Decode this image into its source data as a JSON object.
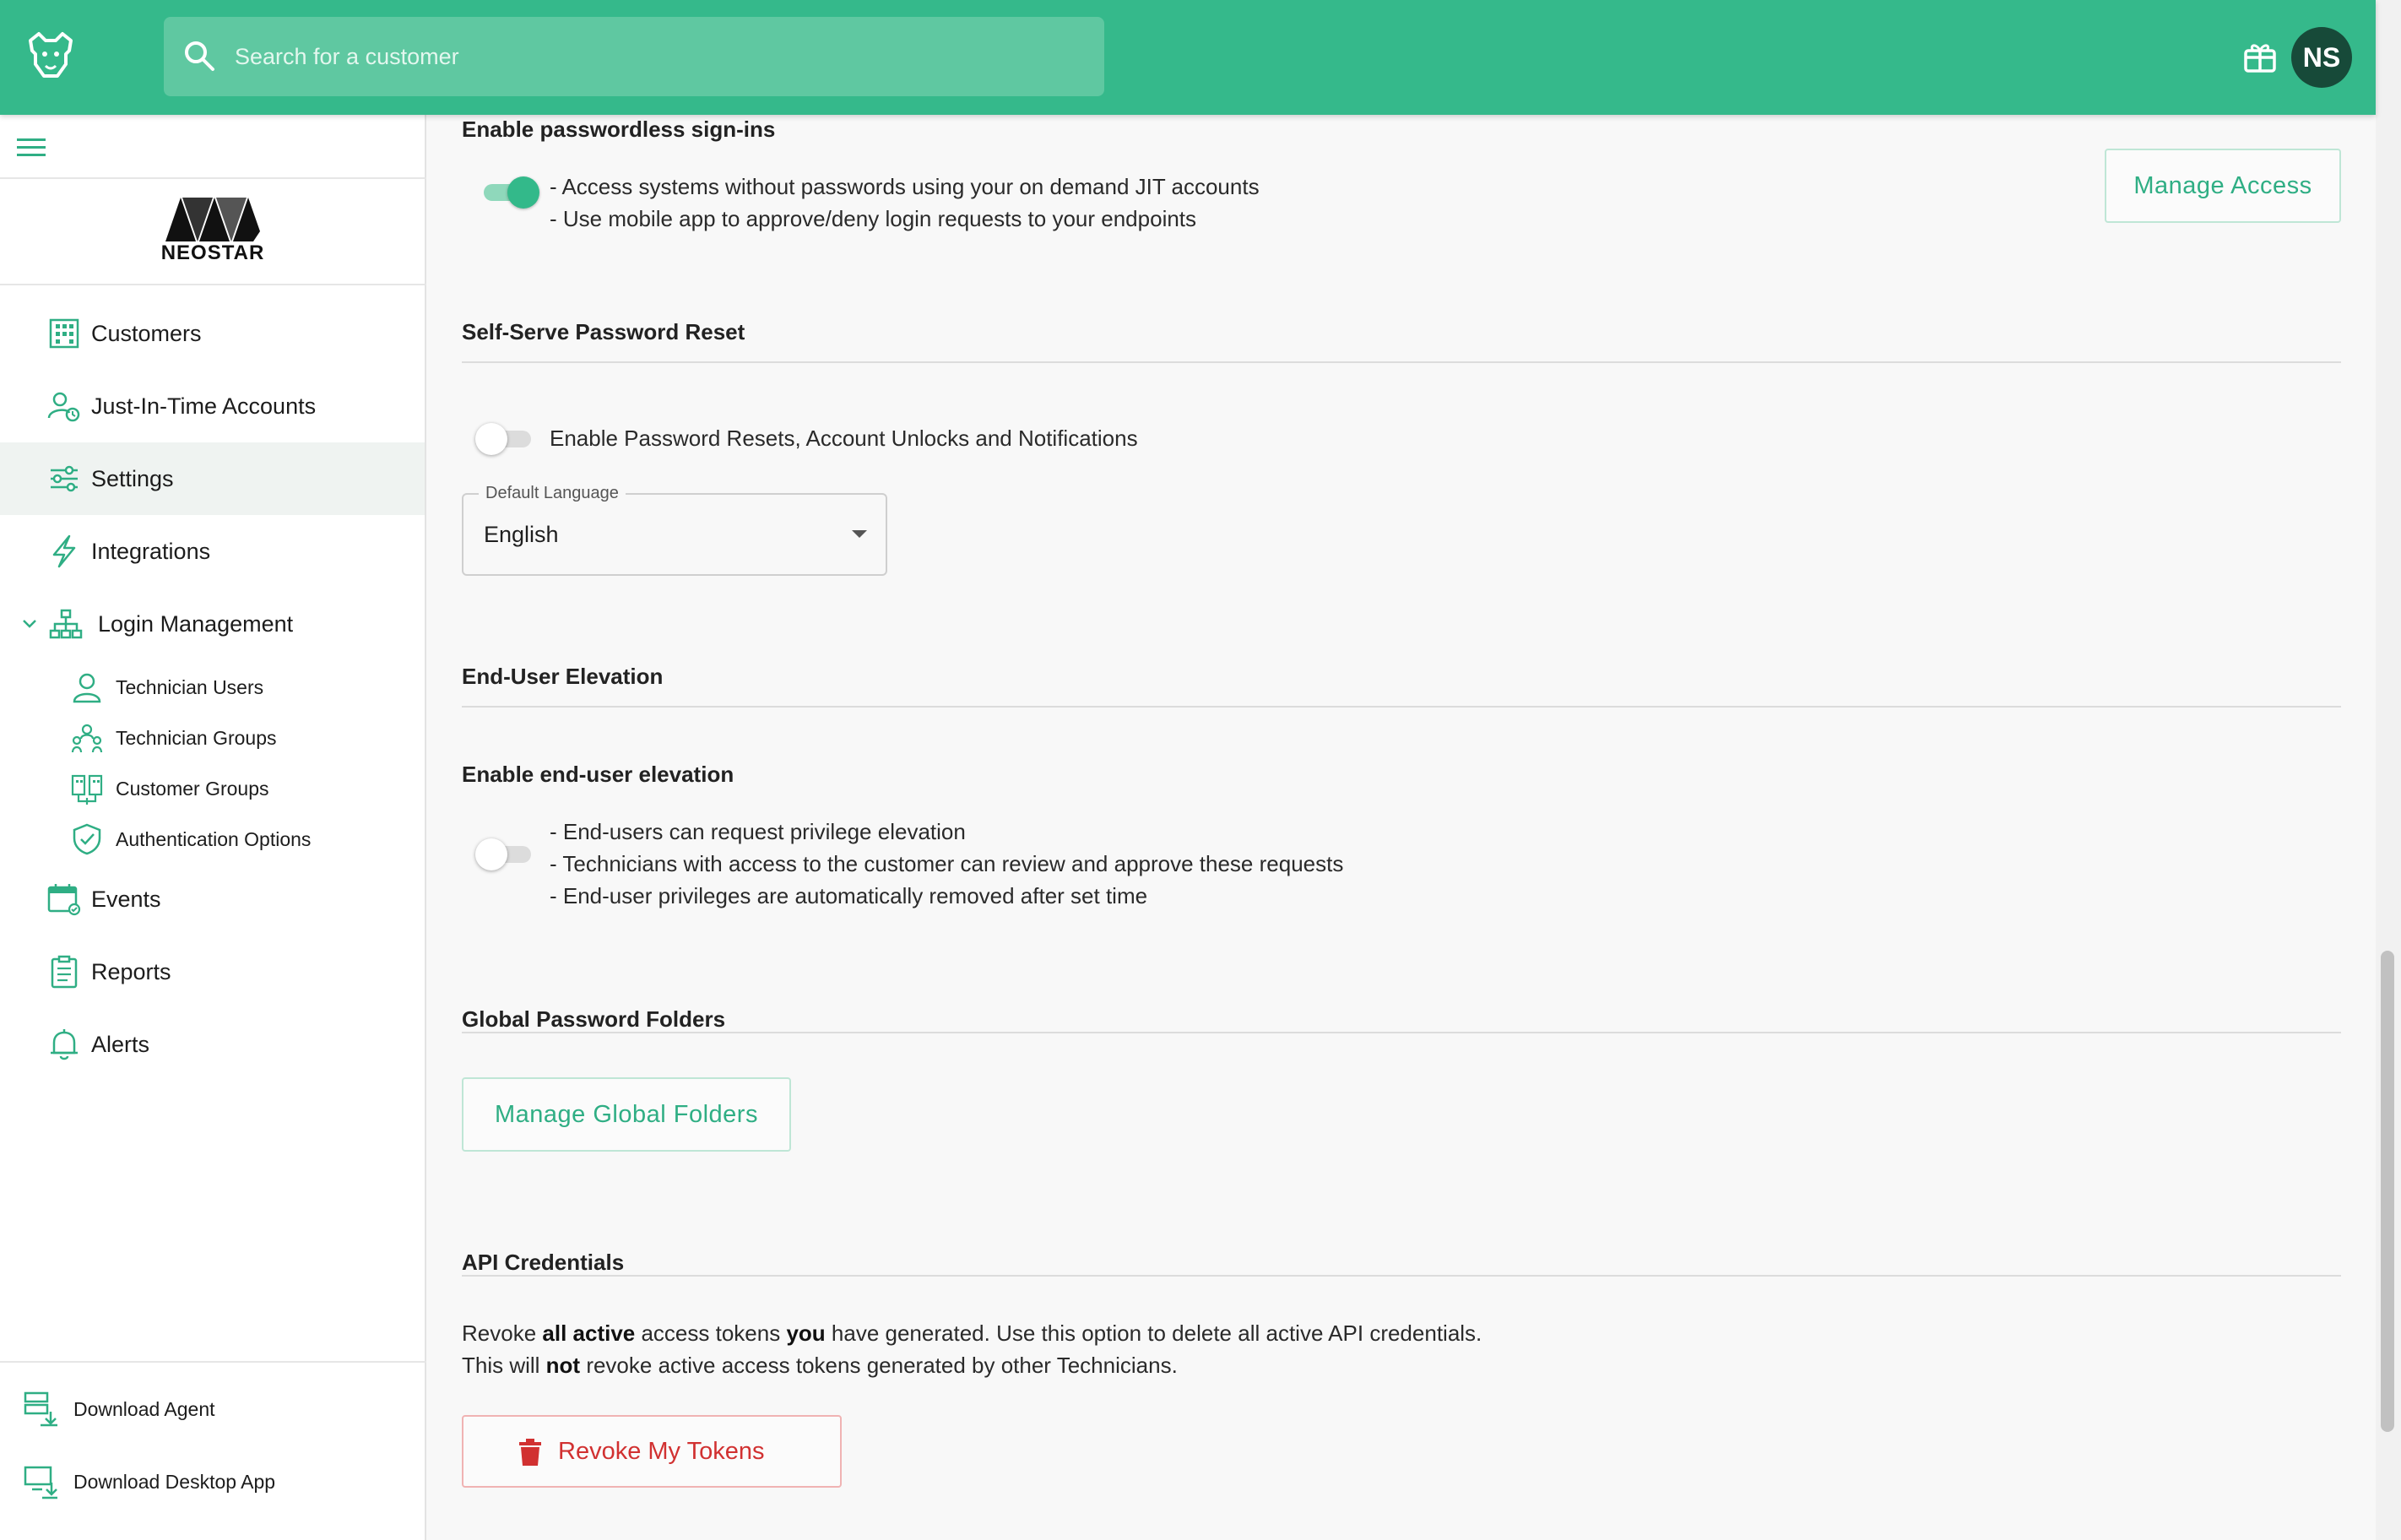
{
  "header": {
    "search_placeholder": "Search for a customer",
    "avatar_initials": "NS",
    "brand_color": "#35b98b"
  },
  "sidebar": {
    "brand_name": "NEOSTAR",
    "items": [
      {
        "label": "Customers",
        "icon": "building-icon"
      },
      {
        "label": "Just-In-Time Accounts",
        "icon": "user-clock-icon"
      },
      {
        "label": "Settings",
        "icon": "sliders-icon",
        "active": true
      },
      {
        "label": "Integrations",
        "icon": "lightning-icon"
      },
      {
        "label": "Login Management",
        "icon": "hierarchy-icon",
        "expanded": true
      },
      {
        "label": "Events",
        "icon": "calendar-icon"
      },
      {
        "label": "Reports",
        "icon": "clipboard-icon"
      },
      {
        "label": "Alerts",
        "icon": "bell-icon"
      }
    ],
    "sub_items": [
      {
        "label": "Technician Users",
        "icon": "user-icon"
      },
      {
        "label": "Technician Groups",
        "icon": "group-icon"
      },
      {
        "label": "Customer Groups",
        "icon": "buildings-icon"
      },
      {
        "label": "Authentication Options",
        "icon": "shield-check-icon"
      }
    ],
    "footer": [
      {
        "label": "Download Agent",
        "icon": "server-download-icon"
      },
      {
        "label": "Download Desktop App",
        "icon": "monitor-download-icon"
      }
    ]
  },
  "passwordless": {
    "title": "Enable passwordless sign-ins",
    "enabled": true,
    "lines": [
      "- Access systems without passwords using your on demand JIT accounts",
      "- Use mobile app to approve/deny login requests to your endpoints"
    ],
    "manage_button": "Manage Access"
  },
  "self_serve": {
    "title": "Self-Serve Password Reset",
    "toggle_label": "Enable Password Resets, Account Unlocks and Notifications",
    "enabled": false,
    "language_label": "Default Language",
    "language_value": "English"
  },
  "elevation": {
    "title": "End-User Elevation",
    "subtitle": "Enable end-user elevation",
    "enabled": false,
    "lines": [
      "- End-users can request privilege elevation",
      "- Technicians with access to the customer can review and approve these requests",
      "- End-user privileges are automatically removed after set time"
    ]
  },
  "global_folders": {
    "title": "Global Password Folders",
    "button": "Manage Global Folders"
  },
  "api": {
    "title": "API Credentials",
    "line1": {
      "a": "Revoke ",
      "b1": "all active",
      "c": " access tokens ",
      "b2": "you",
      "d": " have generated. Use this option to delete all active API credentials."
    },
    "line2": {
      "a": "This will ",
      "b": "not",
      "c": " revoke active access tokens generated by other Technicians."
    },
    "revoke_button": "Revoke My Tokens",
    "danger_color": "#d13131"
  }
}
